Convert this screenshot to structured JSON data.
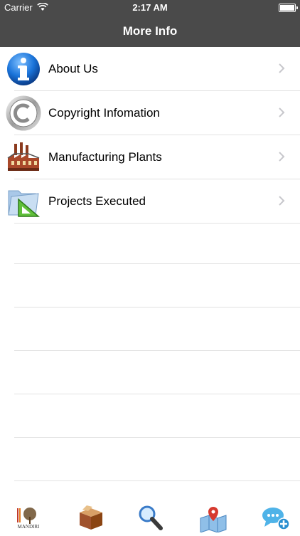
{
  "status_bar": {
    "carrier": "Carrier",
    "time": "2:17 AM"
  },
  "nav": {
    "title": "More Info"
  },
  "menu": [
    {
      "label": "About Us",
      "icon": "info-icon"
    },
    {
      "label": "Copyright Infomation",
      "icon": "copyright-icon"
    },
    {
      "label": "Manufacturing Plants",
      "icon": "factory-icon"
    },
    {
      "label": "Projects Executed",
      "icon": "folder-triangle-icon"
    }
  ],
  "tabbar": {
    "items": [
      {
        "icon": "logo-icon",
        "logo_text": "MANDIRI"
      },
      {
        "icon": "box-icon"
      },
      {
        "icon": "search-icon"
      },
      {
        "icon": "map-icon"
      },
      {
        "icon": "chat-icon"
      }
    ]
  },
  "colors": {
    "bar": "#4a4a4a",
    "separator": "#e2e2e2",
    "info_blue": "#1a73d9"
  }
}
